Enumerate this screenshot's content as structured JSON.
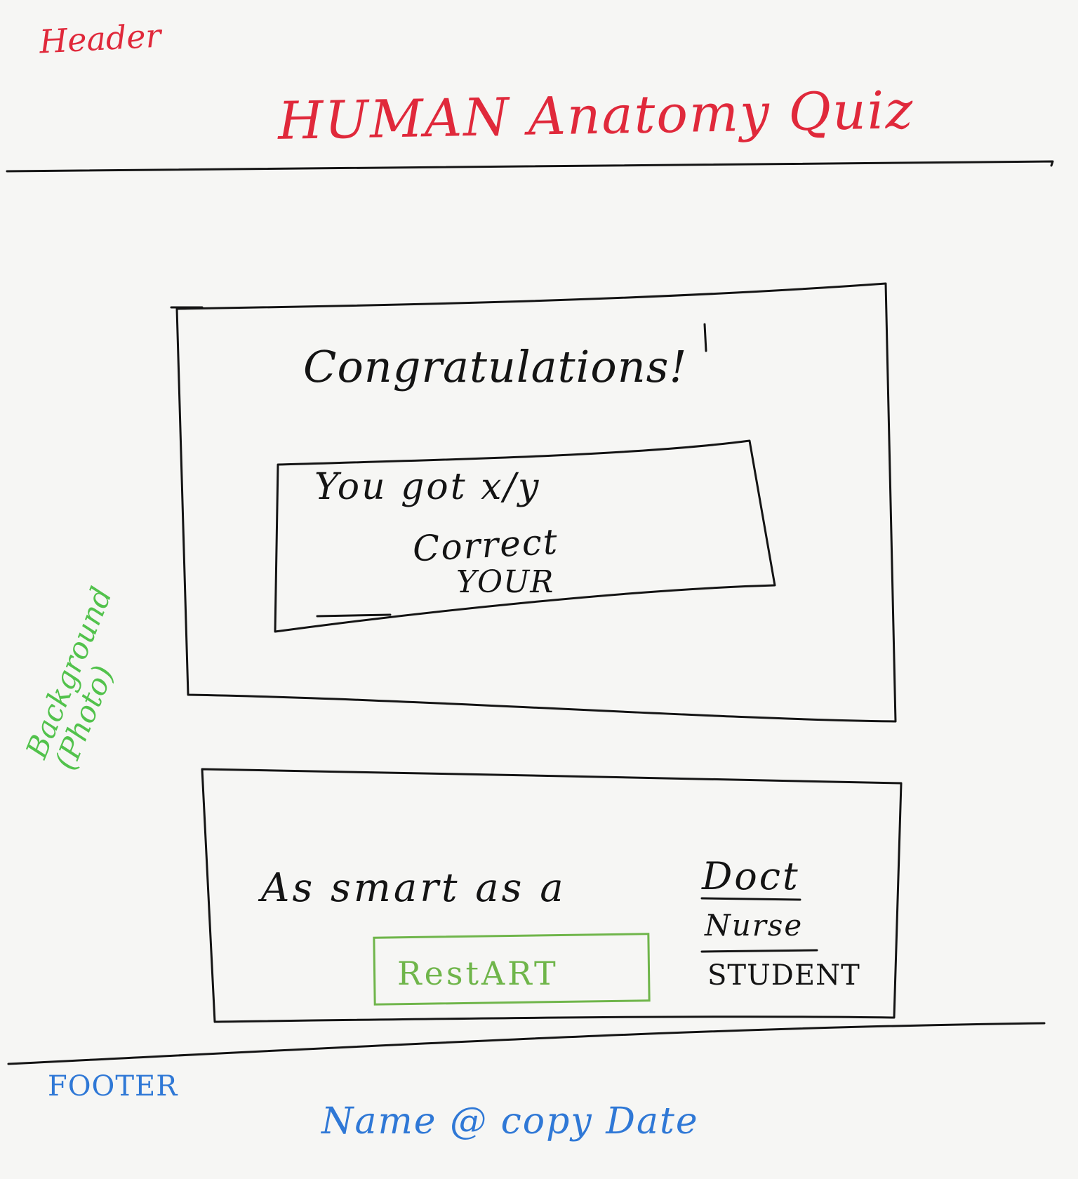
{
  "annotations": {
    "header": "Header",
    "background": "Background\n(Photo)",
    "footer": "FOOTER"
  },
  "header": {
    "title": "HUMAN Anatomy Quiz"
  },
  "results_card": {
    "heading": "Congratulations!",
    "score_line_1": "You got  x/y",
    "score_line_2": "Correct",
    "score_line_3": "YOUR"
  },
  "rank_card": {
    "text": "As smart as a",
    "options": [
      "Doct",
      "Nurse",
      "STUDENT"
    ],
    "restart_label": "RestART"
  },
  "footer": {
    "text": "Name @ copy Date"
  },
  "colors": {
    "ink": "#141414",
    "header_annotation": "#e0293b",
    "footer_annotation": "#2f78d6",
    "background_annotation": "#52c24c",
    "restart_button": "#6fb54a"
  }
}
